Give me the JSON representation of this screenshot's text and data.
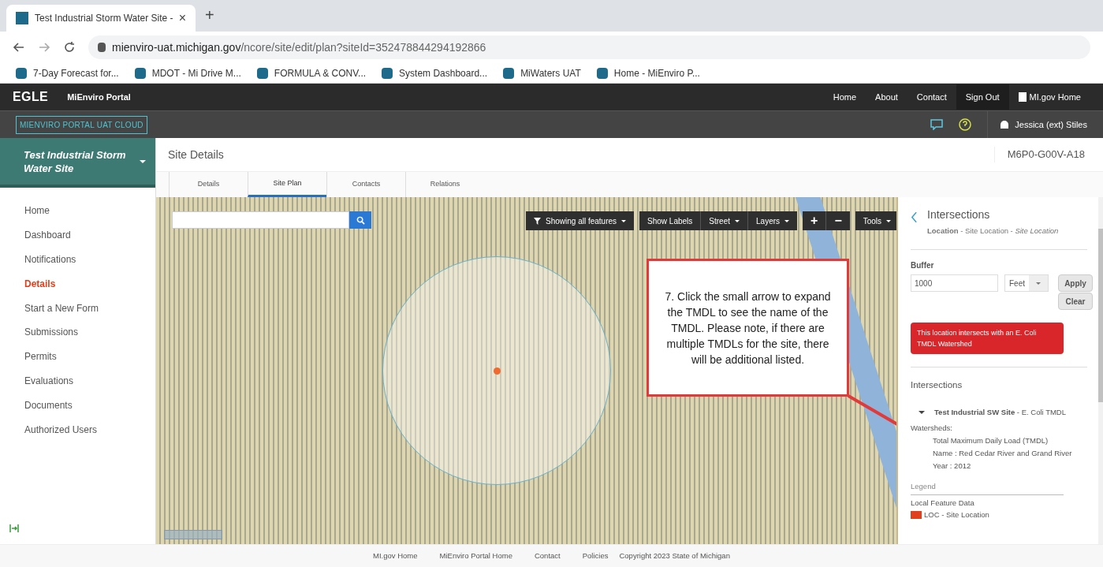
{
  "browser": {
    "tab_title": "Test Industrial Storm Water Site -",
    "tab_close": "×",
    "new_tab": "+",
    "url_host": "mienviro-uat.michigan.gov",
    "url_path": "/ncore/site/edit/plan?siteId=352478844294192866",
    "bookmarks": [
      "7-Day Forecast for...",
      "MDOT - Mi Drive M...",
      "FORMULA & CONV...",
      "System Dashboard...",
      "MiWaters UAT",
      "Home - MiEnviro P..."
    ]
  },
  "header": {
    "logo": "EGLE",
    "portal": "MiEnviro Portal",
    "links": [
      "Home",
      "About",
      "Contact",
      "Sign Out",
      "MI.gov Home"
    ],
    "env_badge": "MIENVIRO PORTAL UAT CLOUD",
    "user": "Jessica (ext) Stiles"
  },
  "sidebar": {
    "site_title": "Test Industrial Storm Water Site",
    "items": [
      {
        "label": "Home",
        "selected": false
      },
      {
        "label": "Dashboard",
        "selected": false
      },
      {
        "label": "Notifications",
        "selected": false
      },
      {
        "label": "Details",
        "selected": true
      },
      {
        "label": "Start a New Form",
        "selected": false
      },
      {
        "label": "Submissions",
        "selected": false
      },
      {
        "label": "Permits",
        "selected": false
      },
      {
        "label": "Evaluations",
        "selected": false
      },
      {
        "label": "Documents",
        "selected": false
      },
      {
        "label": "Authorized Users",
        "selected": false
      }
    ]
  },
  "page": {
    "title": "Site Details",
    "site_id": "M6P0-G00V-A18",
    "tabs": [
      {
        "label": "Details",
        "selected": false
      },
      {
        "label": "Site Plan",
        "selected": true
      },
      {
        "label": "Contacts",
        "selected": false
      },
      {
        "label": "Relations",
        "selected": false
      }
    ]
  },
  "map_toolbar": {
    "filter": "Showing all features",
    "labels": "Show Labels",
    "basemap": "Street",
    "layers": "Layers",
    "zoom_in": "+",
    "zoom_out": "−",
    "tools": "Tools"
  },
  "callout": "7. Click the small arrow to expand the TMDL to see the name of the TMDL.  Please note, if there are multiple TMDLs for the site, there will be additional listed.",
  "panel": {
    "title": "Intersections",
    "subtitle": "**Location** - Site Location - *Site Location*",
    "buffer_label": "Buffer",
    "buffer_value": "1000",
    "unit": "Feet",
    "apply": "Apply",
    "clear": "Clear",
    "alert": "This location intersects with an E. Coli TMDL Watershed",
    "section": "Intersections",
    "item": {
      "title": "**Test Industrial SW Site** - E. Coli TMDL",
      "expanded": true,
      "label": "Watersheds:",
      "lines": [
        "Total Maximum Daily Load (TMDL)",
        "Name : Red Cedar River and Grand River",
        "Year : 2012"
      ]
    },
    "legend": "Legend",
    "legend_group": "Local Feature Data",
    "legend_items": [
      {
        "label": "LOC - Site Location",
        "color": "#e0401e"
      }
    ]
  },
  "footer": [
    "MI.gov Home",
    "MiEnviro Portal Home",
    "Contact",
    "Policies",
    "Copyright 2023 State of Michigan"
  ]
}
